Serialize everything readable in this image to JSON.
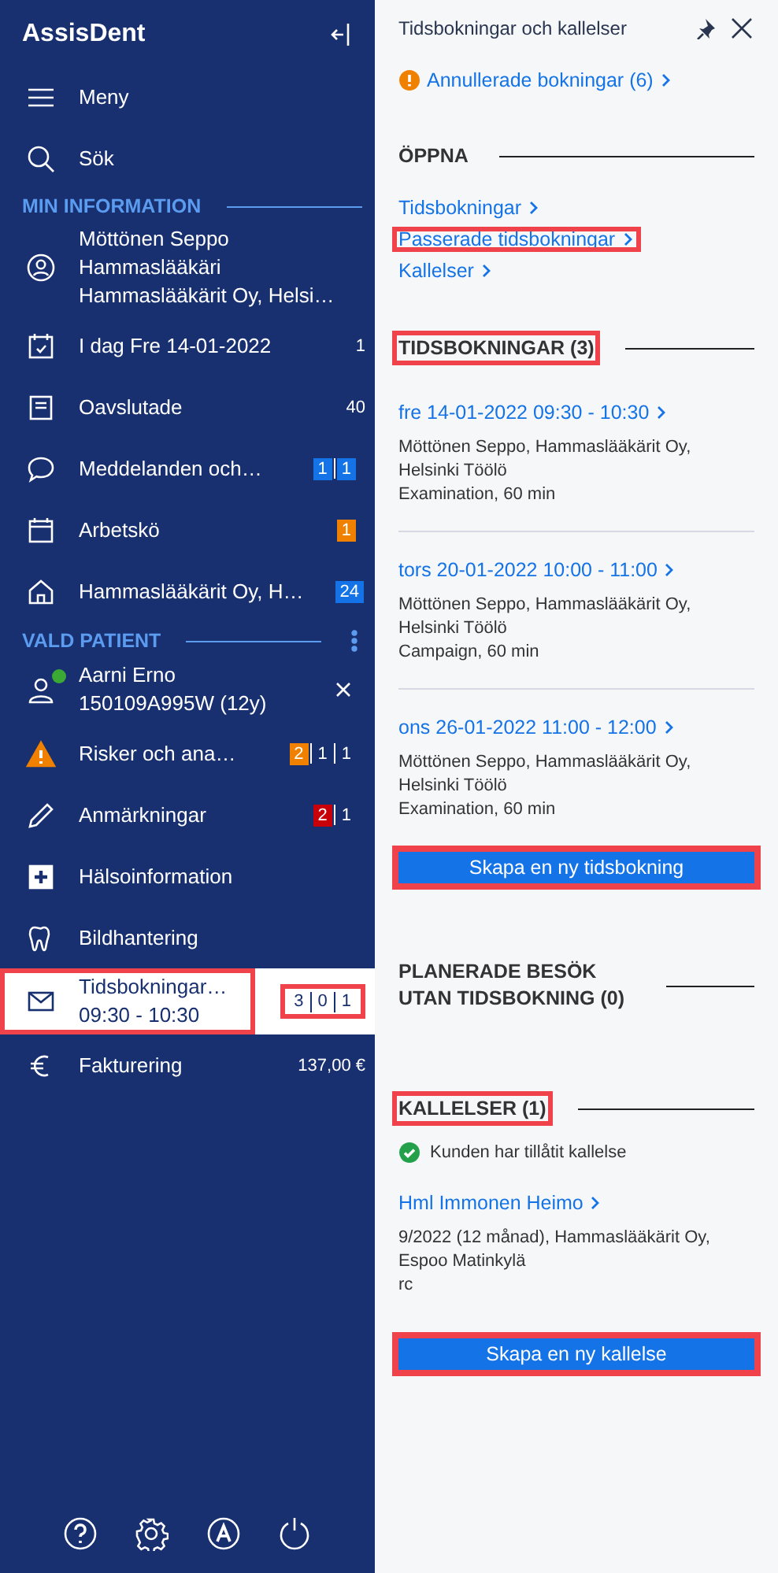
{
  "app": {
    "name": "AssisDent"
  },
  "sidebar": {
    "top_items": [
      {
        "label": "Meny"
      },
      {
        "label": "Sök"
      }
    ],
    "sections": [
      {
        "title": "MIN INFORMATION",
        "has_menu": false,
        "items": [
          {
            "lines": [
              "Möttönen Seppo",
              "Hammaslääkäri",
              "Hammaslääkärit Oy, Helsi…"
            ],
            "selected": false,
            "highlighted": false
          },
          {
            "lines": [
              "I dag Fre 14-01-2022"
            ],
            "count": "1",
            "selected": false,
            "highlighted": false
          },
          {
            "lines": [
              "Oavslutade"
            ],
            "count": "40",
            "selected": false,
            "highlighted": false
          },
          {
            "lines": [
              "Meddelanden och…"
            ],
            "badges": [
              {
                "text": "1",
                "color": "#1473e6"
              },
              {
                "text": "1",
                "color": "#1473e6"
              }
            ],
            "selected": false,
            "highlighted": false
          },
          {
            "lines": [
              "Arbetskö"
            ],
            "badges": [
              {
                "text": "1",
                "color": "#f08000"
              }
            ],
            "selected": false,
            "highlighted": false
          },
          {
            "lines": [
              "Hammaslääkärit Oy, H…"
            ],
            "badges": [
              {
                "text": "24",
                "color": "#1473e6"
              }
            ],
            "selected": false,
            "highlighted": false
          }
        ]
      },
      {
        "title": "VALD PATIENT",
        "has_menu": true,
        "items": [
          {
            "lines": [
              "Aarni Erno",
              "150109A995W (12y)"
            ],
            "online": true,
            "closable": true,
            "selected": false,
            "highlighted": false
          },
          {
            "lines": [
              "Risker och ana…"
            ],
            "badges": [
              {
                "text": "2",
                "color": "#f08000"
              },
              {
                "text": "1"
              },
              {
                "text": "1"
              }
            ],
            "selected": false,
            "highlighted": false
          },
          {
            "lines": [
              "Anmärkningar"
            ],
            "badges": [
              {
                "text": "2",
                "color": "#c8000a"
              },
              {
                "text": "1"
              }
            ],
            "selected": false,
            "highlighted": false
          },
          {
            "lines": [
              "Hälsoinformation"
            ],
            "selected": false,
            "highlighted": false
          },
          {
            "lines": [
              "Bildhantering"
            ],
            "selected": false,
            "highlighted": false
          },
          {
            "lines": [
              "Tidsbokningar…",
              "09:30 - 10:30"
            ],
            "badges": [
              {
                "text": "3"
              },
              {
                "text": "0"
              },
              {
                "text": "1"
              }
            ],
            "selected": true,
            "highlighted": true
          },
          {
            "lines": [
              "Fakturering"
            ],
            "count": "137,00 €",
            "selected": false,
            "highlighted": false
          }
        ]
      }
    ]
  },
  "panel": {
    "title": "Tidsbokningar och kallelser",
    "alert_link": "Annullerade bokningar (6)",
    "sections": [
      {
        "kind": "links",
        "title": "ÖPPNA",
        "highlighted": false,
        "links": [
          {
            "label": "Tidsbokningar",
            "highlighted": false
          },
          {
            "label": "Passerade tidsbokningar",
            "highlighted": true
          },
          {
            "label": "Kallelser",
            "highlighted": false
          }
        ]
      },
      {
        "kind": "bookings",
        "title": "TIDSBOKNINGAR (3)",
        "highlighted": true,
        "bookings": [
          {
            "time": "fre 14-01-2022 09:30 - 10:30",
            "place": "Möttönen Seppo, Hammaslääkärit Oy, Helsinki Töölö",
            "detail": "Examination, 60 min"
          },
          {
            "time": "tors 20-01-2022 10:00 - 11:00",
            "place": "Möttönen Seppo, Hammaslääkärit Oy, Helsinki Töölö",
            "detail": "Campaign, 60 min"
          },
          {
            "time": "ons 26-01-2022 11:00 - 12:00",
            "place": "Möttönen Seppo, Hammaslääkärit Oy, Helsinki Töölö",
            "detail": "Examination, 60 min"
          }
        ],
        "button": {
          "label": "Skapa en ny tidsbokning",
          "highlighted": true
        }
      },
      {
        "kind": "planned",
        "title": "PLANERADE BESÖK UTAN TIDSBOKNING (0)",
        "highlighted": false
      },
      {
        "kind": "invitations",
        "title": "KALLELSER (1)",
        "highlighted": true,
        "consent": "Kunden har tillåtit kallelse",
        "items": [
          {
            "link": "Hml Immonen Heimo",
            "place": "9/2022 (12 månad), Hammaslääkärit Oy, Espoo Matinkylä",
            "detail": "rc"
          }
        ],
        "button": {
          "label": "Skapa en ny kallelse",
          "highlighted": true
        }
      }
    ]
  }
}
